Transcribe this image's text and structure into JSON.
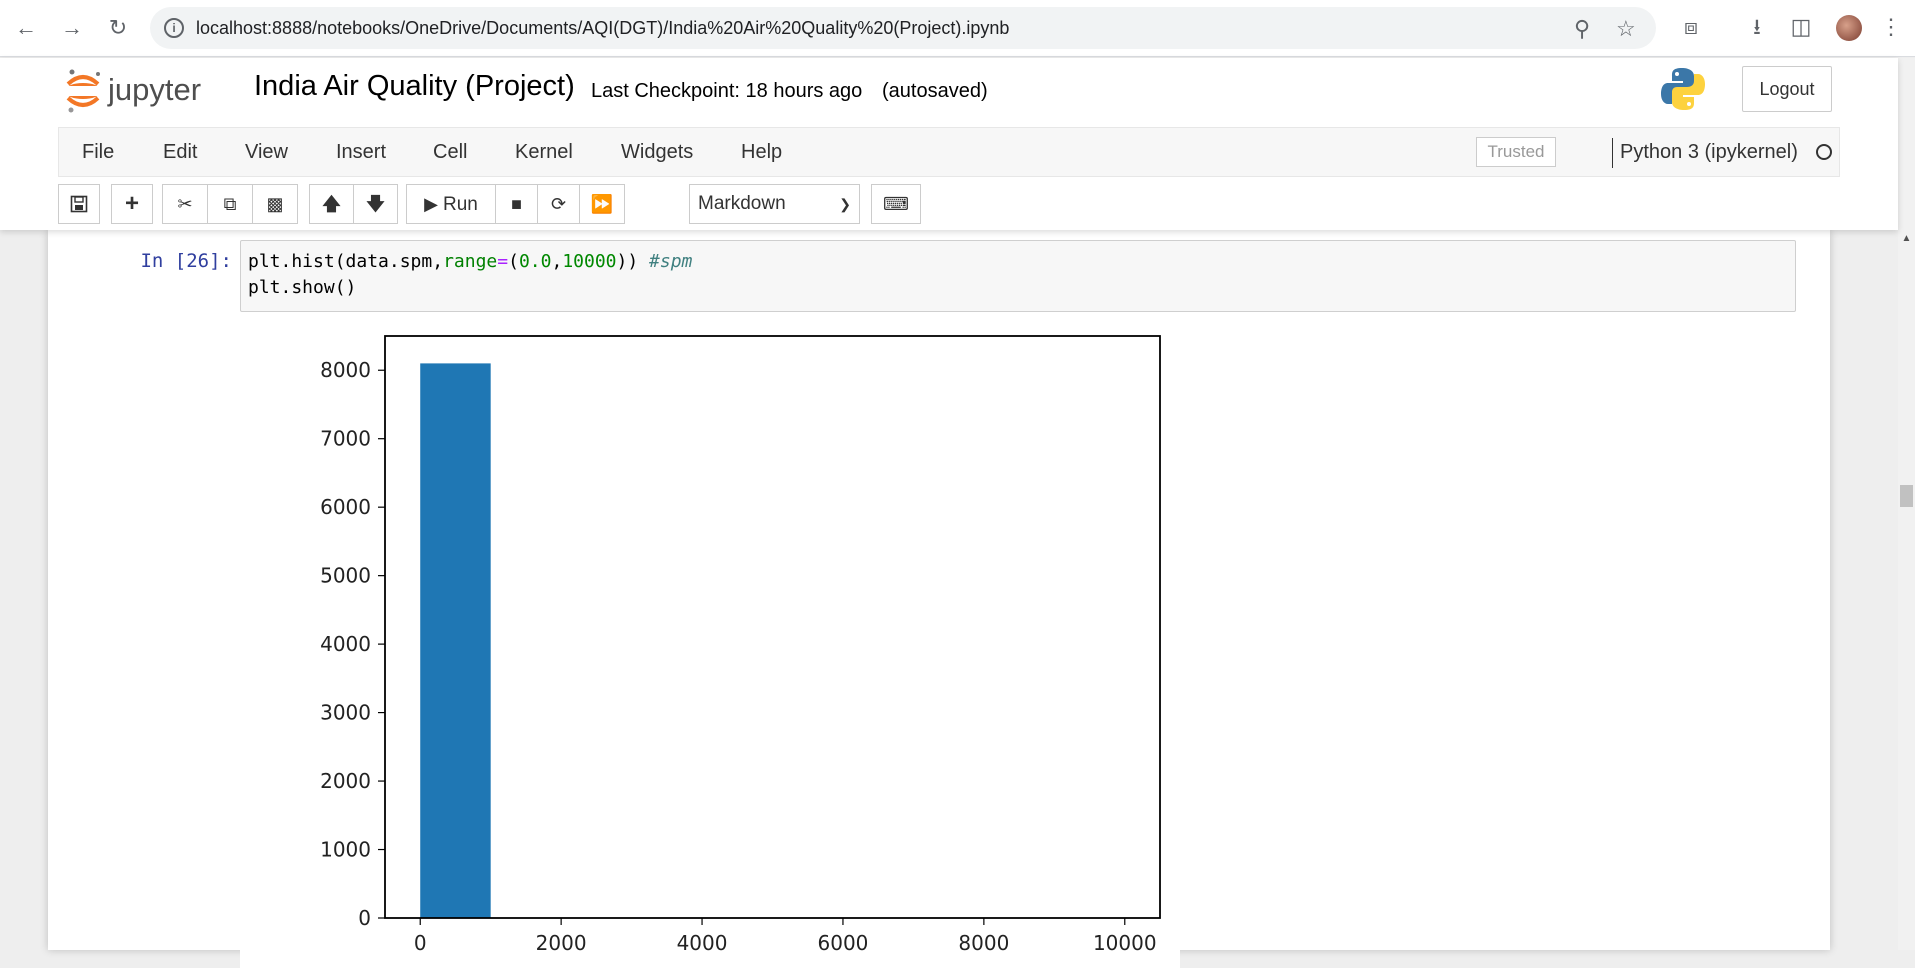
{
  "browser": {
    "url": "localhost:8888/notebooks/OneDrive/Documents/AQI(DGT)/India%20Air%20Quality%20(Project).ipynb"
  },
  "header": {
    "logo_text": "jupyter",
    "notebook_title": "India Air Quality (Project)",
    "checkpoint": "Last Checkpoint: 18 hours ago",
    "autosave": "(autosaved)",
    "logout_label": "Logout"
  },
  "menu": {
    "items": [
      "File",
      "Edit",
      "View",
      "Insert",
      "Cell",
      "Kernel",
      "Widgets",
      "Help"
    ],
    "trusted": "Trusted",
    "kernel": "Python 3 (ipykernel)"
  },
  "toolbar": {
    "run_label": "Run",
    "cell_type": "Markdown"
  },
  "cell": {
    "prompt": "In [26]:"
  },
  "chart_data": {
    "type": "bar",
    "x_bins": [
      [
        0,
        1000
      ]
    ],
    "values": [
      8100
    ],
    "xlim": [
      -500,
      10500
    ],
    "ylim": [
      0,
      8500
    ],
    "xticks": [
      0,
      2000,
      4000,
      6000,
      8000,
      10000
    ],
    "yticks": [
      0,
      1000,
      2000,
      3000,
      4000,
      5000,
      6000,
      7000,
      8000
    ],
    "bar_color": "#1f77b4"
  }
}
